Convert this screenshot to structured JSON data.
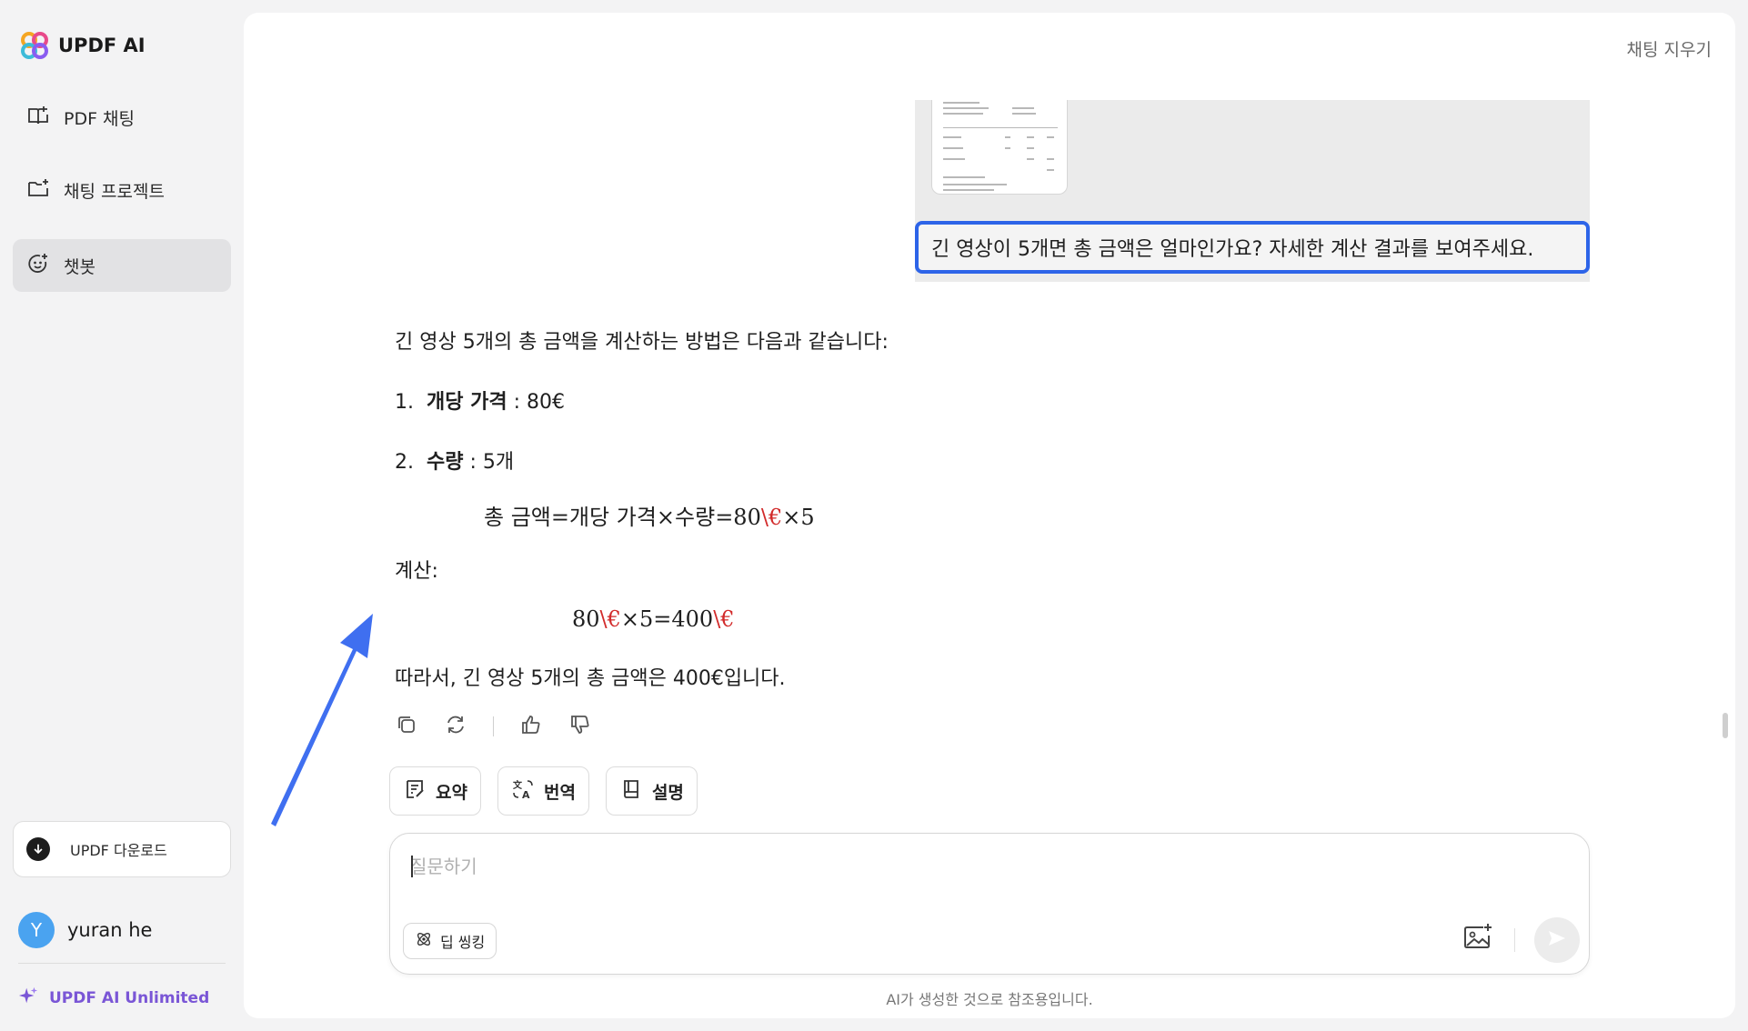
{
  "app": {
    "name": "UPDF AI"
  },
  "sidebar": {
    "items": [
      {
        "label": "PDF 채팅",
        "icon": "book-chat-icon"
      },
      {
        "label": "채팅 프로젝트",
        "icon": "folder-plus-icon"
      },
      {
        "label": "챗봇",
        "icon": "bot-face-icon",
        "active": true
      }
    ],
    "download_label": "UPDF 다운로드",
    "user": {
      "initial": "Y",
      "name": "yuran he"
    },
    "plan_label": "UPDF AI Unlimited"
  },
  "header": {
    "clear_chat": "채팅 지우기"
  },
  "conversation": {
    "user_question": "긴 영상이 5개면 총 금액은 얼마인가요? 자세한 계산 결과를 보여주세요.",
    "answer": {
      "intro": "긴 영상 5개의 총 금액을 계산하는 방법은 다음과 같습니다:",
      "item1_num": "1.",
      "item1_bold": "개당 가격",
      "item1_rest": " : 80€",
      "item2_num": "2.",
      "item2_bold": "수량",
      "item2_rest": " : 5개",
      "formula1_a": "총 금액=개당 가격×수량=80",
      "formula1_red": "\\€",
      "formula1_b": "×5",
      "calc_label": "계산:",
      "formula2_a": "80",
      "formula2_red1": "\\€",
      "formula2_b": "×5=400",
      "formula2_red2": "\\€",
      "conclusion": "따라서, 긴 영상 5개의 총 금액은 400€입니다."
    }
  },
  "quick_actions": [
    {
      "label": "요약",
      "icon": "summary-icon"
    },
    {
      "label": "번역",
      "icon": "translate-icon"
    },
    {
      "label": "설명",
      "icon": "book-icon"
    }
  ],
  "input": {
    "placeholder": "질문하기",
    "deep_think_label": "딥 씽킹"
  },
  "footer": {
    "disclaimer": "AI가 생성한 것으로 참조용입니다."
  },
  "colors": {
    "accent_blue": "#2d64e8",
    "brand_purple": "#7a56d6",
    "math_red": "#d22b2b"
  }
}
